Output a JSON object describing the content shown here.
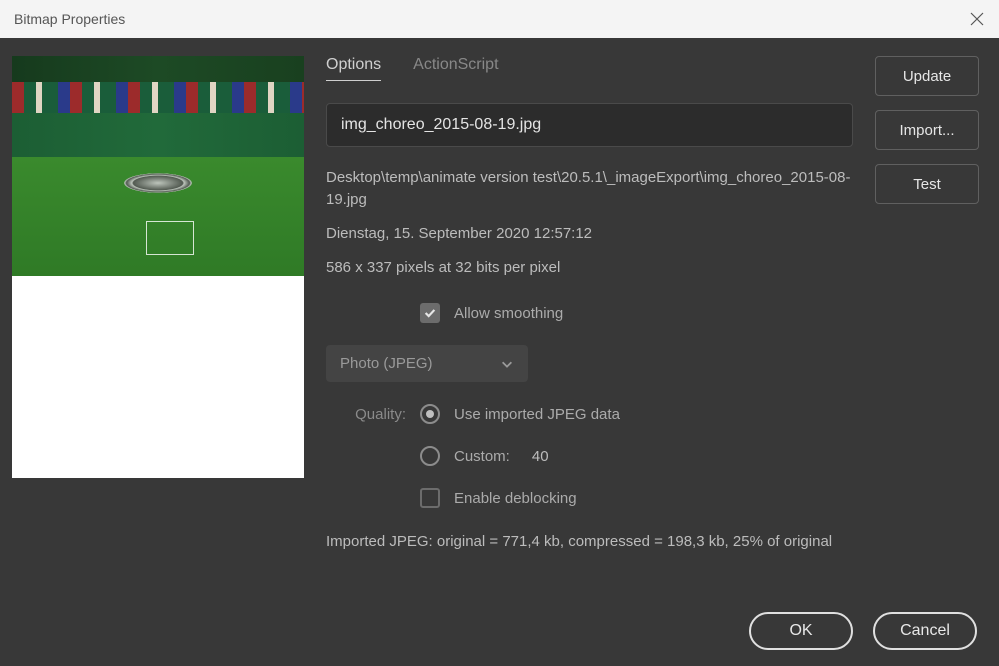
{
  "window": {
    "title": "Bitmap Properties"
  },
  "tabs": {
    "options": "Options",
    "actionscript": "ActionScript"
  },
  "filename": "img_choreo_2015-08-19.jpg",
  "path": "Desktop\\temp\\animate version test\\20.5.1\\_imageExport\\img_choreo_2015-08-19.jpg",
  "date": "Dienstag, 15. September 2020  12:57:12",
  "dimensions": "586 x 337 pixels at 32 bits per pixel",
  "smoothing_label": "Allow smoothing",
  "compression_option": "Photo (JPEG)",
  "quality": {
    "label": "Quality:",
    "imported_label": "Use imported JPEG data",
    "custom_label": "Custom:",
    "custom_value": "40",
    "deblock_label": "Enable deblocking"
  },
  "imported_note": "Imported JPEG: original = 771,4 kb, compressed = 198,3 kb, 25% of original",
  "buttons": {
    "update": "Update",
    "import": "Import...",
    "test": "Test",
    "ok": "OK",
    "cancel": "Cancel"
  }
}
